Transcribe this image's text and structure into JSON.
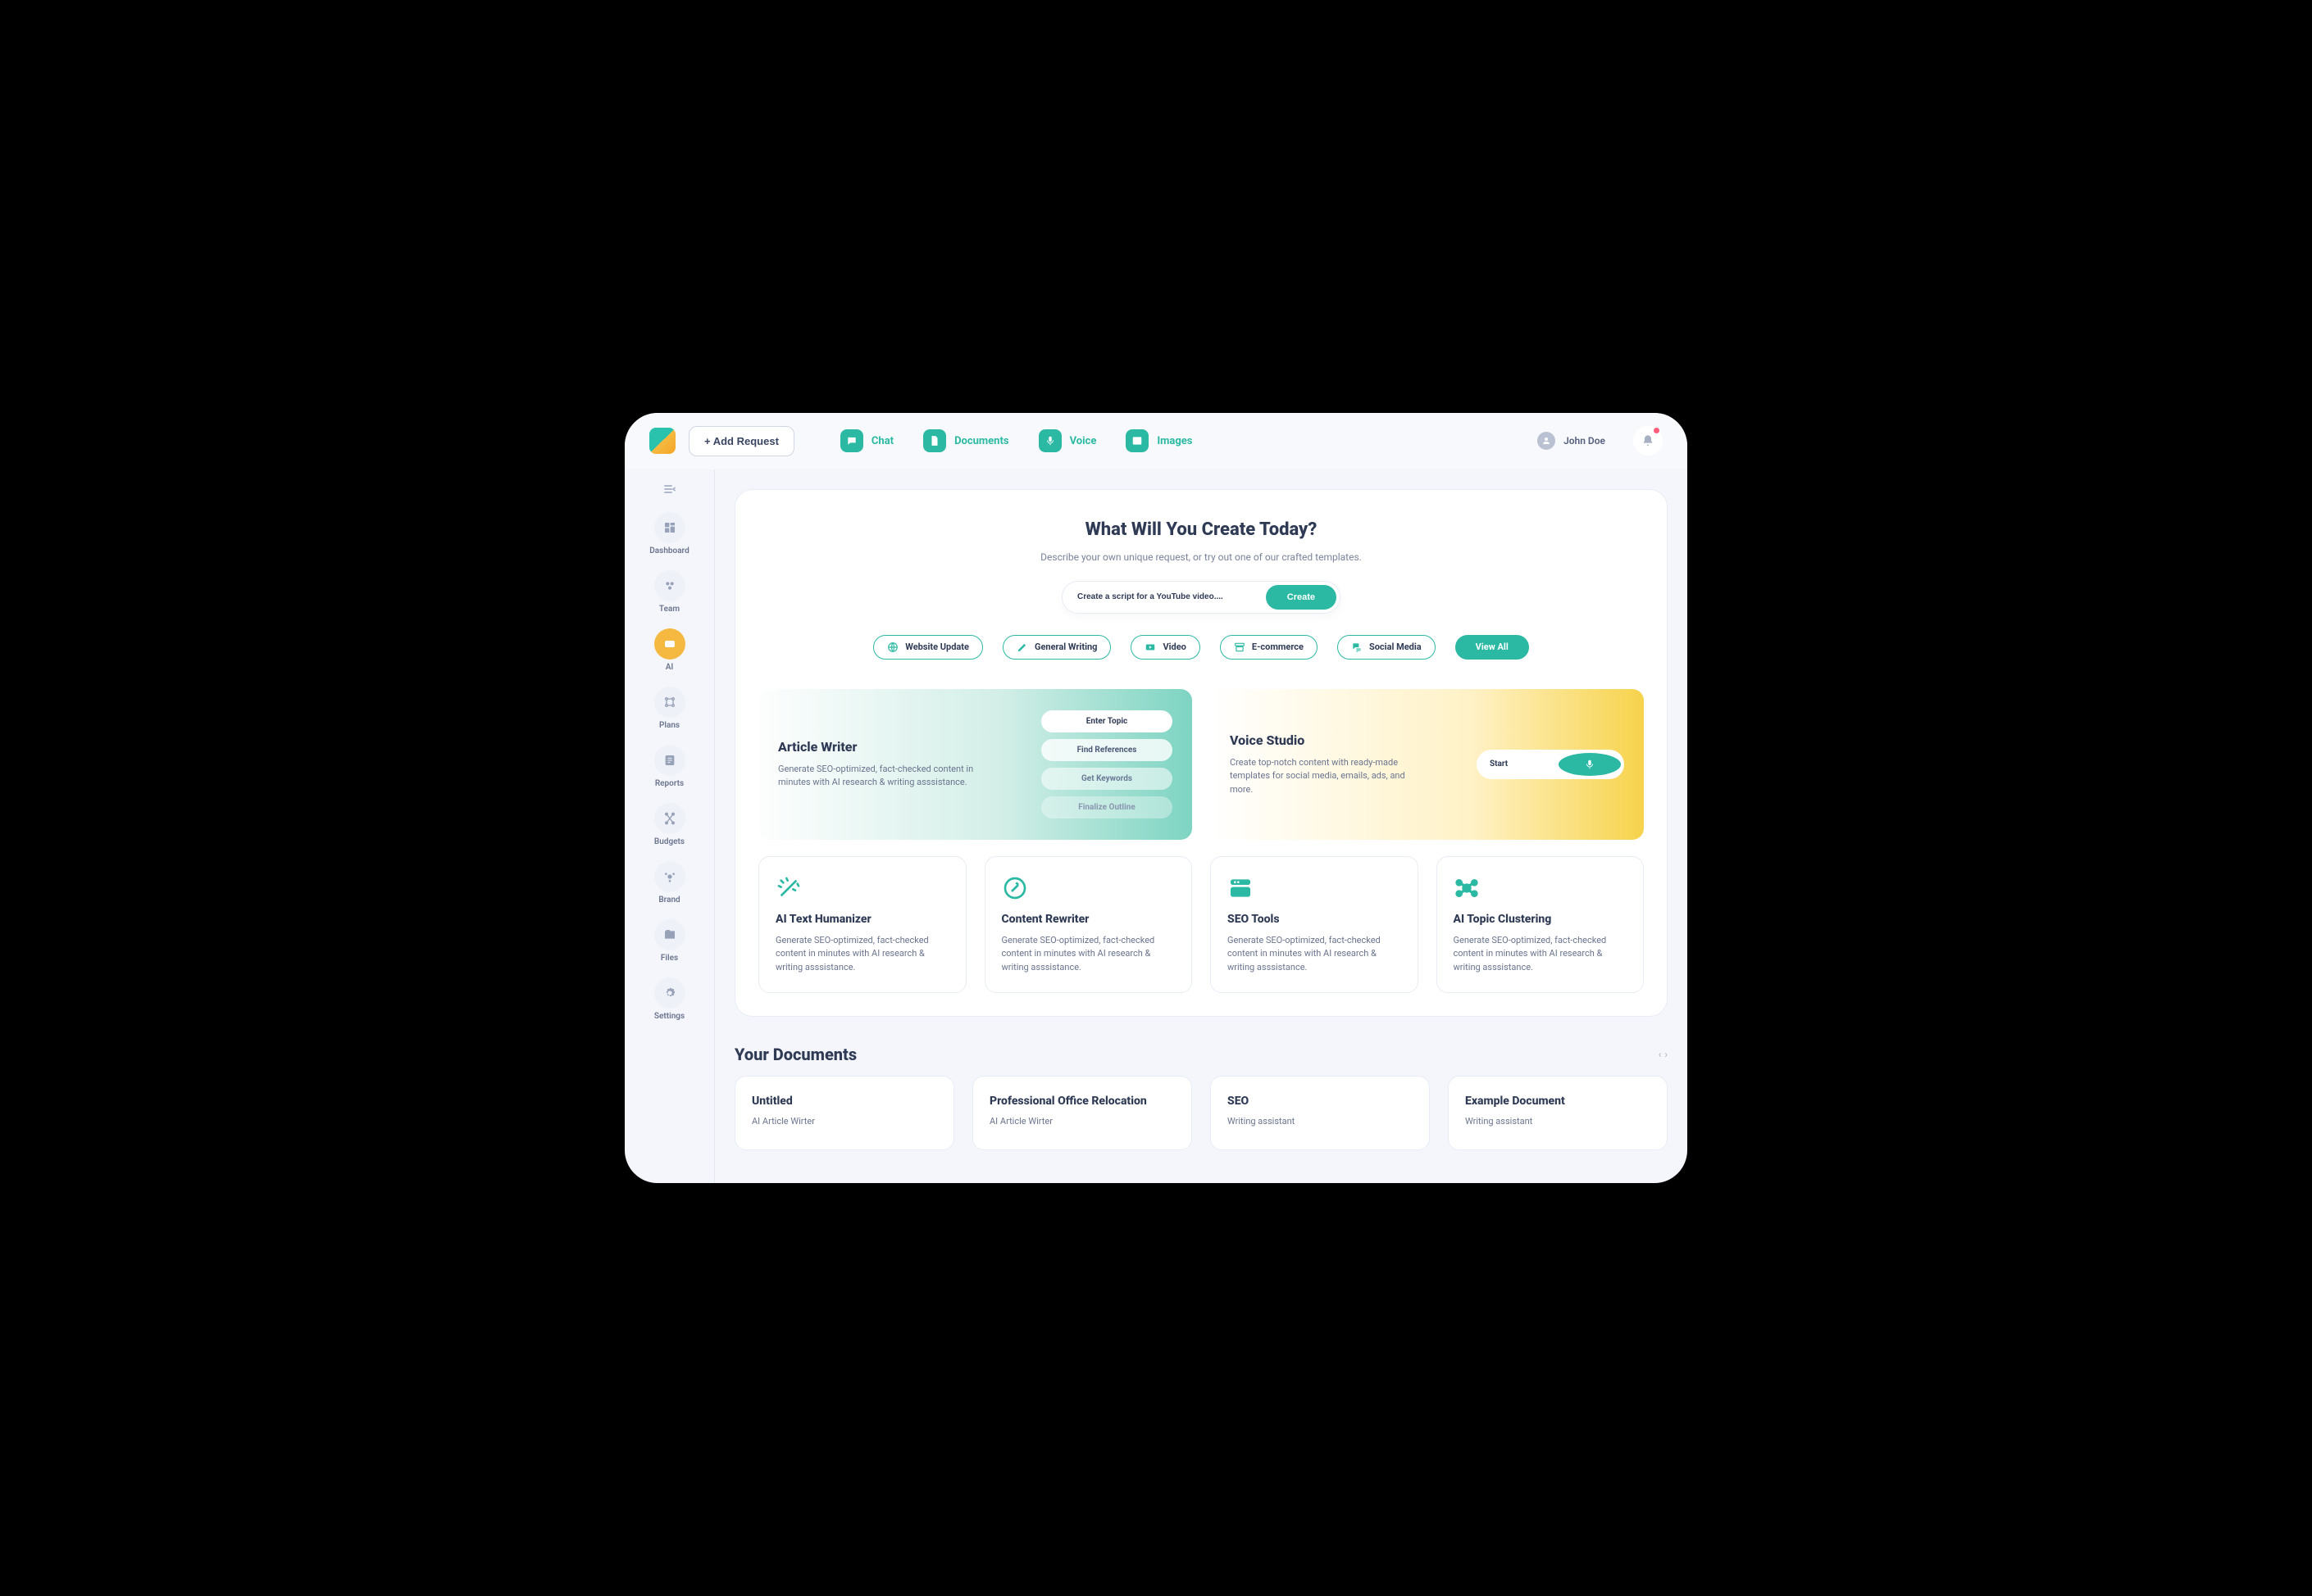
{
  "colors": {
    "accent": "#2bb9a4",
    "accent2": "#f5b942"
  },
  "header": {
    "addRequest": "+ Add Request",
    "nav": [
      {
        "key": "chat",
        "label": "Chat"
      },
      {
        "key": "documents",
        "label": "Documents"
      },
      {
        "key": "voice",
        "label": "Voice"
      },
      {
        "key": "images",
        "label": "Images"
      }
    ],
    "userName": "John Doe"
  },
  "sidebar": {
    "items": [
      {
        "key": "dashboard",
        "label": "Dashboard"
      },
      {
        "key": "team",
        "label": "Team"
      },
      {
        "key": "ai",
        "label": "AI",
        "active": true
      },
      {
        "key": "plans",
        "label": "Plans"
      },
      {
        "key": "reports",
        "label": "Reports"
      },
      {
        "key": "budgets",
        "label": "Budgets"
      },
      {
        "key": "brand",
        "label": "Brand"
      },
      {
        "key": "files",
        "label": "Files"
      },
      {
        "key": "settings",
        "label": "Settings"
      }
    ]
  },
  "hero": {
    "title": "What Will You Create Today?",
    "subtitle": "Describe your own unique request, or try out one of our crafted templates.",
    "placeholder": "Create a script for a YouTube video....",
    "createLabel": "Create",
    "chips": [
      {
        "key": "website",
        "label": "Website Update"
      },
      {
        "key": "general",
        "label": "General Writing"
      },
      {
        "key": "video",
        "label": "Video"
      },
      {
        "key": "ecom",
        "label": "E-commerce"
      },
      {
        "key": "social",
        "label": "Social Media"
      }
    ],
    "viewAll": "View All"
  },
  "features": {
    "article": {
      "title": "Article Writer",
      "desc": "Generate SEO-optimized, fact-checked content in minutes with AI research & writing asssistance.",
      "steps": [
        "Enter Topic",
        "Find References",
        "Get Keywords",
        "Finalize Outline"
      ]
    },
    "voice": {
      "title": "Voice Studio",
      "desc": "Create top-notch content with ready-made templates for social media, emails, ads, and more.",
      "startLabel": "Start"
    }
  },
  "tools": [
    {
      "key": "humanizer",
      "title": "AI Text Humanizer",
      "desc": "Generate SEO-optimized, fact-checked content in minutes with AI research & writing asssistance."
    },
    {
      "key": "rewriter",
      "title": "Content Rewriter",
      "desc": "Generate SEO-optimized, fact-checked content in minutes with AI research & writing asssistance."
    },
    {
      "key": "seo",
      "title": "SEO Tools",
      "desc": "Generate SEO-optimized, fact-checked content in minutes with AI research & writing asssistance."
    },
    {
      "key": "clustering",
      "title": "AI Topic Clustering",
      "desc": "Generate SEO-optimized, fact-checked content in minutes with AI research & writing asssistance."
    }
  ],
  "documents": {
    "heading": "Your Documents",
    "items": [
      {
        "title": "Untitled",
        "sub": "AI Article Wirter"
      },
      {
        "title": "Professional Office Relocation",
        "sub": "AI Article Wirter"
      },
      {
        "title": "SEO",
        "sub": "Writing assistant"
      },
      {
        "title": "Example Document",
        "sub": "Writing assistant"
      }
    ]
  }
}
